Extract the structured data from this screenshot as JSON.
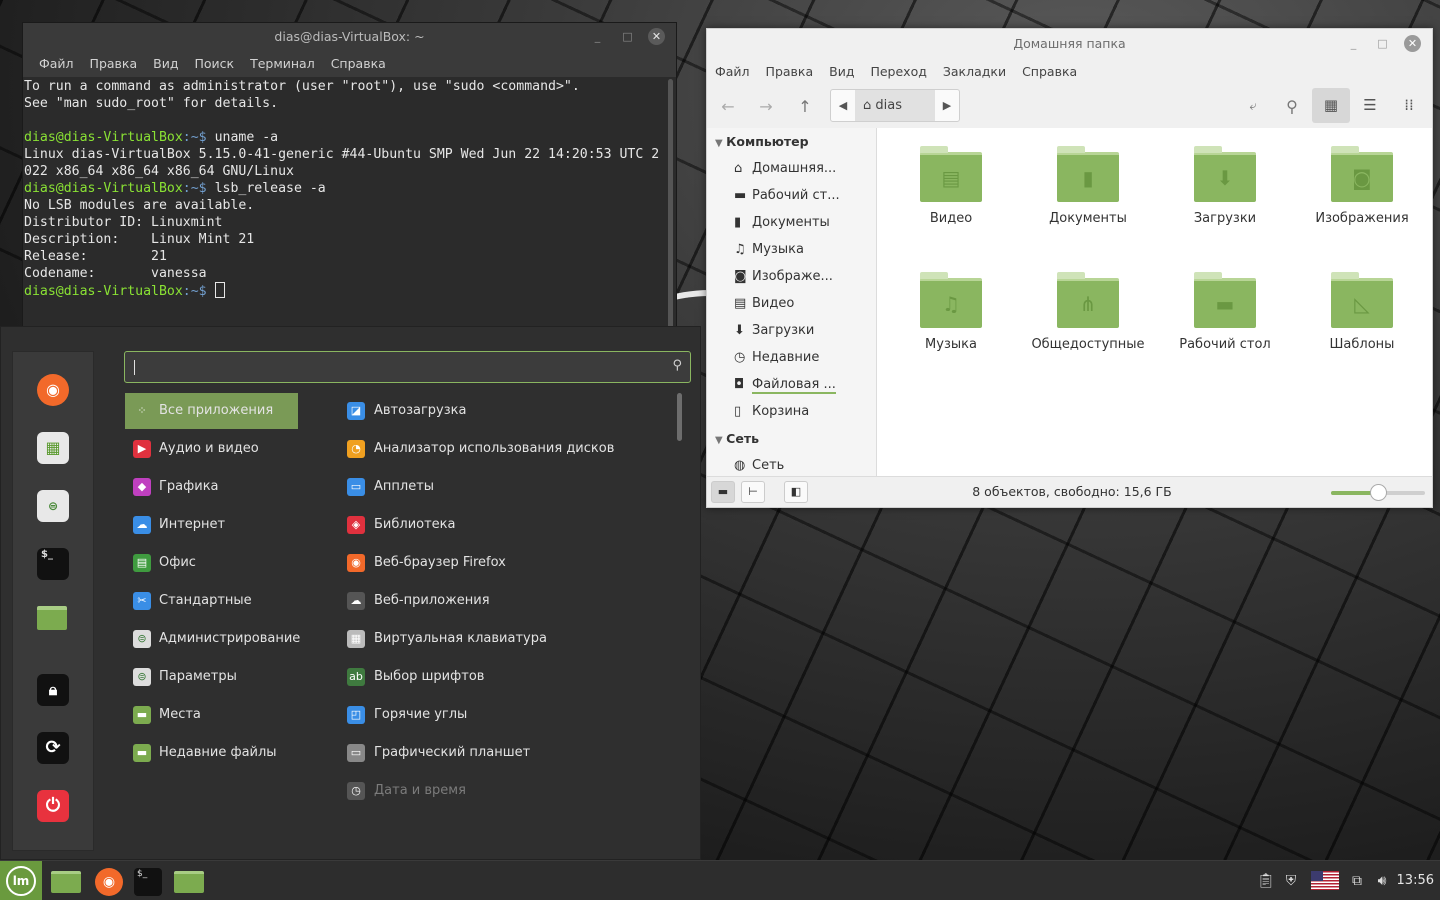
{
  "terminal": {
    "title": "dias@dias-VirtualBox: ~",
    "menu": [
      "Файл",
      "Правка",
      "Вид",
      "Поиск",
      "Терминал",
      "Справка"
    ],
    "lines": [
      {
        "text": "To run a command as administrator (user \"root\"), use \"sudo <command>\"."
      },
      {
        "text": "See \"man sudo_root\" for details."
      },
      {
        "text": ""
      },
      {
        "prompt_user": "dias@dias-VirtualBox",
        "prompt_path": ":~$ ",
        "cmd": "uname -a"
      },
      {
        "text": "Linux dias-VirtualBox 5.15.0-41-generic #44-Ubuntu SMP Wed Jun 22 14:20:53 UTC 2"
      },
      {
        "text": "022 x86_64 x86_64 x86_64 GNU/Linux"
      },
      {
        "prompt_user": "dias@dias-VirtualBox",
        "prompt_path": ":~$ ",
        "cmd": "lsb_release -a"
      },
      {
        "text": "No LSB modules are available."
      },
      {
        "text": "Distributor ID:\tLinuxmint"
      },
      {
        "text": "Description:\tLinux Mint 21"
      },
      {
        "text": "Release:\t21"
      },
      {
        "text": "Codename:\tvanessa"
      }
    ],
    "final_prompt_user": "dias@dias-VirtualBox",
    "final_prompt_path": ":~$ "
  },
  "file_manager": {
    "title": "Домашняя папка",
    "menu": [
      "Файл",
      "Правка",
      "Вид",
      "Переход",
      "Закладки",
      "Справка"
    ],
    "path_crumb": "dias",
    "sidebar": {
      "computer_header": "Компьютер",
      "computer_items": [
        {
          "label": "Домашняя...",
          "icon": "home-icon"
        },
        {
          "label": "Рабочий ст...",
          "icon": "desktop-icon"
        },
        {
          "label": "Документы",
          "icon": "document-icon"
        },
        {
          "label": "Музыка",
          "icon": "music-icon"
        },
        {
          "label": "Изображе...",
          "icon": "camera-icon"
        },
        {
          "label": "Видео",
          "icon": "film-icon"
        },
        {
          "label": "Загрузки",
          "icon": "download-icon"
        },
        {
          "label": "Недавние",
          "icon": "clock-icon"
        },
        {
          "label": "Файловая ...",
          "icon": "drive-icon"
        },
        {
          "label": "Корзина",
          "icon": "trash-icon"
        }
      ],
      "network_header": "Сеть",
      "network_items": [
        {
          "label": "Сеть",
          "icon": "network-icon"
        }
      ]
    },
    "folders": [
      {
        "label": "Видео",
        "glyph": "film-icon"
      },
      {
        "label": "Документы",
        "glyph": "document-icon"
      },
      {
        "label": "Загрузки",
        "glyph": "download-icon"
      },
      {
        "label": "Изображения",
        "glyph": "camera-icon"
      },
      {
        "label": "Музыка",
        "glyph": "music-icon"
      },
      {
        "label": "Общедоступные",
        "glyph": "share-icon"
      },
      {
        "label": "Рабочий стол",
        "glyph": "desktop-icon"
      },
      {
        "label": "Шаблоны",
        "glyph": "template-icon"
      }
    ],
    "status_text": "8 объектов, свободно: 15,6 ГБ",
    "zoom_level": 0.5,
    "accent": "#8ab660"
  },
  "mint_menu": {
    "search_value": "",
    "categories": [
      {
        "label": "Все приложения",
        "icon": "grid-icon",
        "color": "#7a9a56"
      },
      {
        "label": "Аудио и видео",
        "icon": "play-icon",
        "color": "#e0313e"
      },
      {
        "label": "Графика",
        "icon": "graphics-icon",
        "color": "#c040c0"
      },
      {
        "label": "Интернет",
        "icon": "cloud-icon",
        "color": "#3a8ee6"
      },
      {
        "label": "Офис",
        "icon": "office-icon",
        "color": "#3f9b3f"
      },
      {
        "label": "Стандартные",
        "icon": "scissors-icon",
        "color": "#3a8ee6"
      },
      {
        "label": "Администрирование",
        "icon": "toggles-icon",
        "color": "#dddddd"
      },
      {
        "label": "Параметры",
        "icon": "settings-icon",
        "color": "#dddddd"
      },
      {
        "label": "Места",
        "icon": "folder-icon",
        "color": "#7cab4f"
      },
      {
        "label": "Недавние файлы",
        "icon": "recent-folder-icon",
        "color": "#7cab4f"
      }
    ],
    "apps": [
      {
        "label": "Автозагрузка",
        "icon": "autostart-icon",
        "color": "#3a8ee6"
      },
      {
        "label": "Анализатор использования дисков",
        "icon": "disk-usage-icon",
        "color": "#f0a020"
      },
      {
        "label": "Апплеты",
        "icon": "applets-icon",
        "color": "#3a8ee6"
      },
      {
        "label": "Библиотека",
        "icon": "library-icon",
        "color": "#e0313e"
      },
      {
        "label": "Веб-браузер Firefox",
        "icon": "firefox-icon",
        "color": "#f2692a"
      },
      {
        "label": "Веб-приложения",
        "icon": "webapps-icon",
        "color": "#555555"
      },
      {
        "label": "Виртуальная клавиатура",
        "icon": "keyboard-icon",
        "color": "#bbbbbb"
      },
      {
        "label": "Выбор шрифтов",
        "icon": "font-icon",
        "color": "#3f7a3f"
      },
      {
        "label": "Горячие углы",
        "icon": "hot-corners-icon",
        "color": "#3a8ee6"
      },
      {
        "label": "Графический планшет",
        "icon": "tablet-icon",
        "color": "#888888"
      },
      {
        "label": "Дата и время",
        "icon": "clock-icon",
        "color": "#555555",
        "dim": true
      }
    ]
  },
  "panel": {
    "clock": "13:56"
  }
}
